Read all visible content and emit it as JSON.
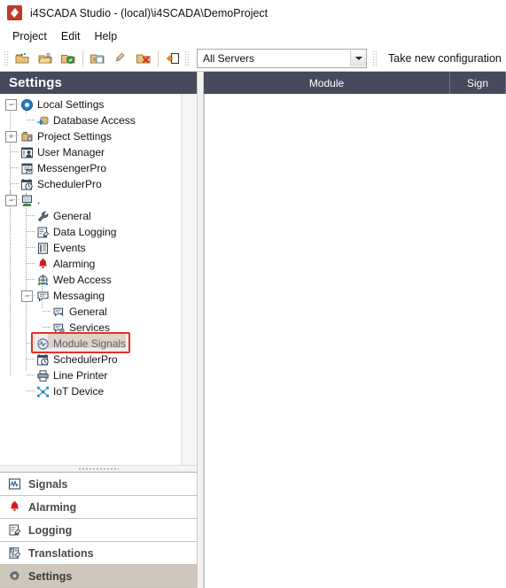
{
  "window": {
    "title": "i4SCADA Studio - (local)\\i4SCADA\\DemoProject",
    "logo_icon": "i4scada-diamond-logo"
  },
  "menubar": {
    "items": [
      {
        "label": "Project"
      },
      {
        "label": "Edit"
      },
      {
        "label": "Help"
      }
    ]
  },
  "toolbar": {
    "buttons": [
      {
        "name": "new-project-button",
        "icon": "folder-new-icon"
      },
      {
        "name": "open-project-button",
        "icon": "folder-open-icon"
      },
      {
        "name": "save-project-button",
        "icon": "folder-green-icon"
      },
      {
        "name": "import-button",
        "icon": "folder-window-icon"
      },
      {
        "name": "clean-button",
        "icon": "brush-icon"
      },
      {
        "name": "delete-project-button",
        "icon": "folder-delete-icon"
      },
      {
        "name": "logout-button",
        "icon": "exit-arrow-icon"
      }
    ],
    "server_filter": {
      "value": "All Servers",
      "placeholder": "All Servers",
      "dropdown_icon": "chevron-down-icon"
    },
    "take_configuration_label": "Take new configuration"
  },
  "settings_panel": {
    "header": "Settings",
    "tree": [
      {
        "label": "Local Settings",
        "icon": "gear-blue-icon",
        "level": 0,
        "expander": "minus"
      },
      {
        "label": "Database Access",
        "icon": "database-arrow-icon",
        "level": 1,
        "expander": "none"
      },
      {
        "label": "Project Settings",
        "icon": "project-settings-icon",
        "level": 0,
        "expander": "plus"
      },
      {
        "label": "User Manager",
        "icon": "user-manager-icon",
        "level": 0,
        "expander": "none"
      },
      {
        "label": "MessengerPro",
        "icon": "messenger-icon",
        "level": 0,
        "expander": "none"
      },
      {
        "label": "SchedulerPro",
        "icon": "scheduler-icon",
        "level": 0,
        "expander": "none"
      },
      {
        "label": ".",
        "icon": "computer-icon",
        "level": 0,
        "expander": "minus"
      },
      {
        "label": "General",
        "icon": "wrench-icon",
        "level": 1,
        "expander": "none"
      },
      {
        "label": "Data Logging",
        "icon": "data-logging-icon",
        "level": 1,
        "expander": "none"
      },
      {
        "label": "Events",
        "icon": "events-icon",
        "level": 1,
        "expander": "none"
      },
      {
        "label": "Alarming",
        "icon": "alarm-bell-icon",
        "level": 1,
        "expander": "none"
      },
      {
        "label": "Web Access",
        "icon": "globe-icon",
        "level": 1,
        "expander": "none"
      },
      {
        "label": "Messaging",
        "icon": "messaging-icon",
        "level": 1,
        "expander": "minus"
      },
      {
        "label": "General",
        "icon": "message-general-icon",
        "level": 2,
        "expander": "none"
      },
      {
        "label": "Services",
        "icon": "message-services-icon",
        "level": 2,
        "expander": "none"
      },
      {
        "label": "Module Signals",
        "icon": "module-signals-icon",
        "level": 1,
        "expander": "none",
        "selected": true,
        "highlighted": true
      },
      {
        "label": "SchedulerPro",
        "icon": "scheduler-icon",
        "level": 1,
        "expander": "none"
      },
      {
        "label": "Line Printer",
        "icon": "printer-icon",
        "level": 1,
        "expander": "none"
      },
      {
        "label": "IoT Device",
        "icon": "iot-device-icon",
        "level": 1,
        "expander": "none"
      }
    ]
  },
  "nav": {
    "items": [
      {
        "label": "Signals",
        "icon": "signals-icon",
        "active": false
      },
      {
        "label": "Alarming",
        "icon": "alarm-bell-icon",
        "active": false
      },
      {
        "label": "Logging",
        "icon": "data-logging-icon",
        "active": false
      },
      {
        "label": "Translations",
        "icon": "translations-icon",
        "active": false
      },
      {
        "label": "Settings",
        "icon": "gear-icon",
        "active": true
      }
    ]
  },
  "grid": {
    "columns": [
      {
        "label": "Module"
      },
      {
        "label": "Sign"
      }
    ],
    "rows": []
  },
  "colors": {
    "panel_header_bg": "#464A5C",
    "selection_outline": "#E03423",
    "nav_active_bg": "#CFC7BB",
    "accent_red": "#C0392B"
  }
}
